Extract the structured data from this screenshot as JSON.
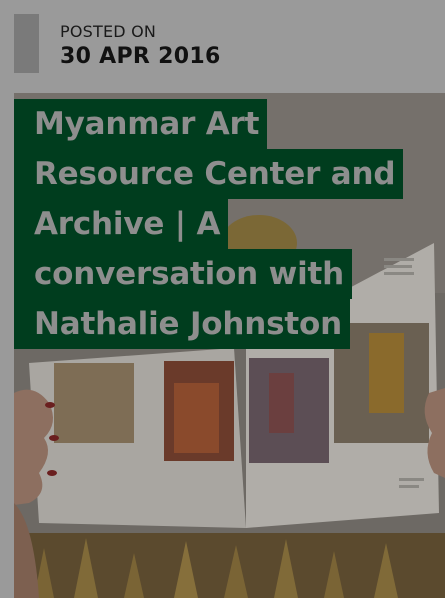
{
  "post": {
    "posted_label": "POSTED ON",
    "posted_date": "30 APR 2016",
    "title_lines": [
      "Myanmar Art",
      "Resource Center and",
      "Archive | A",
      "conversation with",
      "Nathalie Johnston"
    ],
    "hero_image": "person-holding-open-art-book-photo"
  },
  "colors": {
    "title_background": "#003d1e",
    "title_text": "#8e8e8e",
    "page_background": "#9a9a9a"
  }
}
